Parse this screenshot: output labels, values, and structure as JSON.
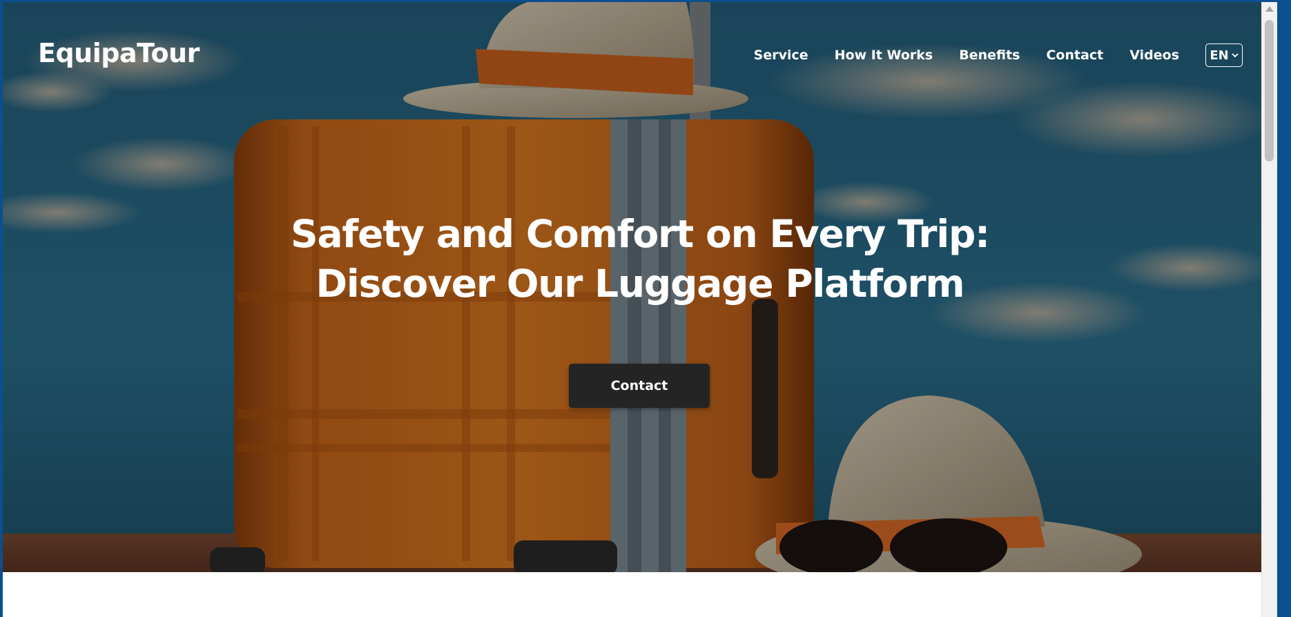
{
  "header": {
    "logo": "EquipaTour",
    "nav": [
      "Service",
      "How It Works",
      "Benefits",
      "Contact",
      "Videos"
    ],
    "language": "EN"
  },
  "hero": {
    "headline_line1": "Safety and Comfort on Every Trip:",
    "headline_line2": "Discover Our Luggage Platform",
    "cta_label": "Contact"
  },
  "colors": {
    "sky": "#2a6e8c",
    "suitcase": "#d9761c",
    "cta_bg": "#242424",
    "text": "#ffffff"
  },
  "icons": {
    "language_dropdown": "chevron-down-icon"
  }
}
